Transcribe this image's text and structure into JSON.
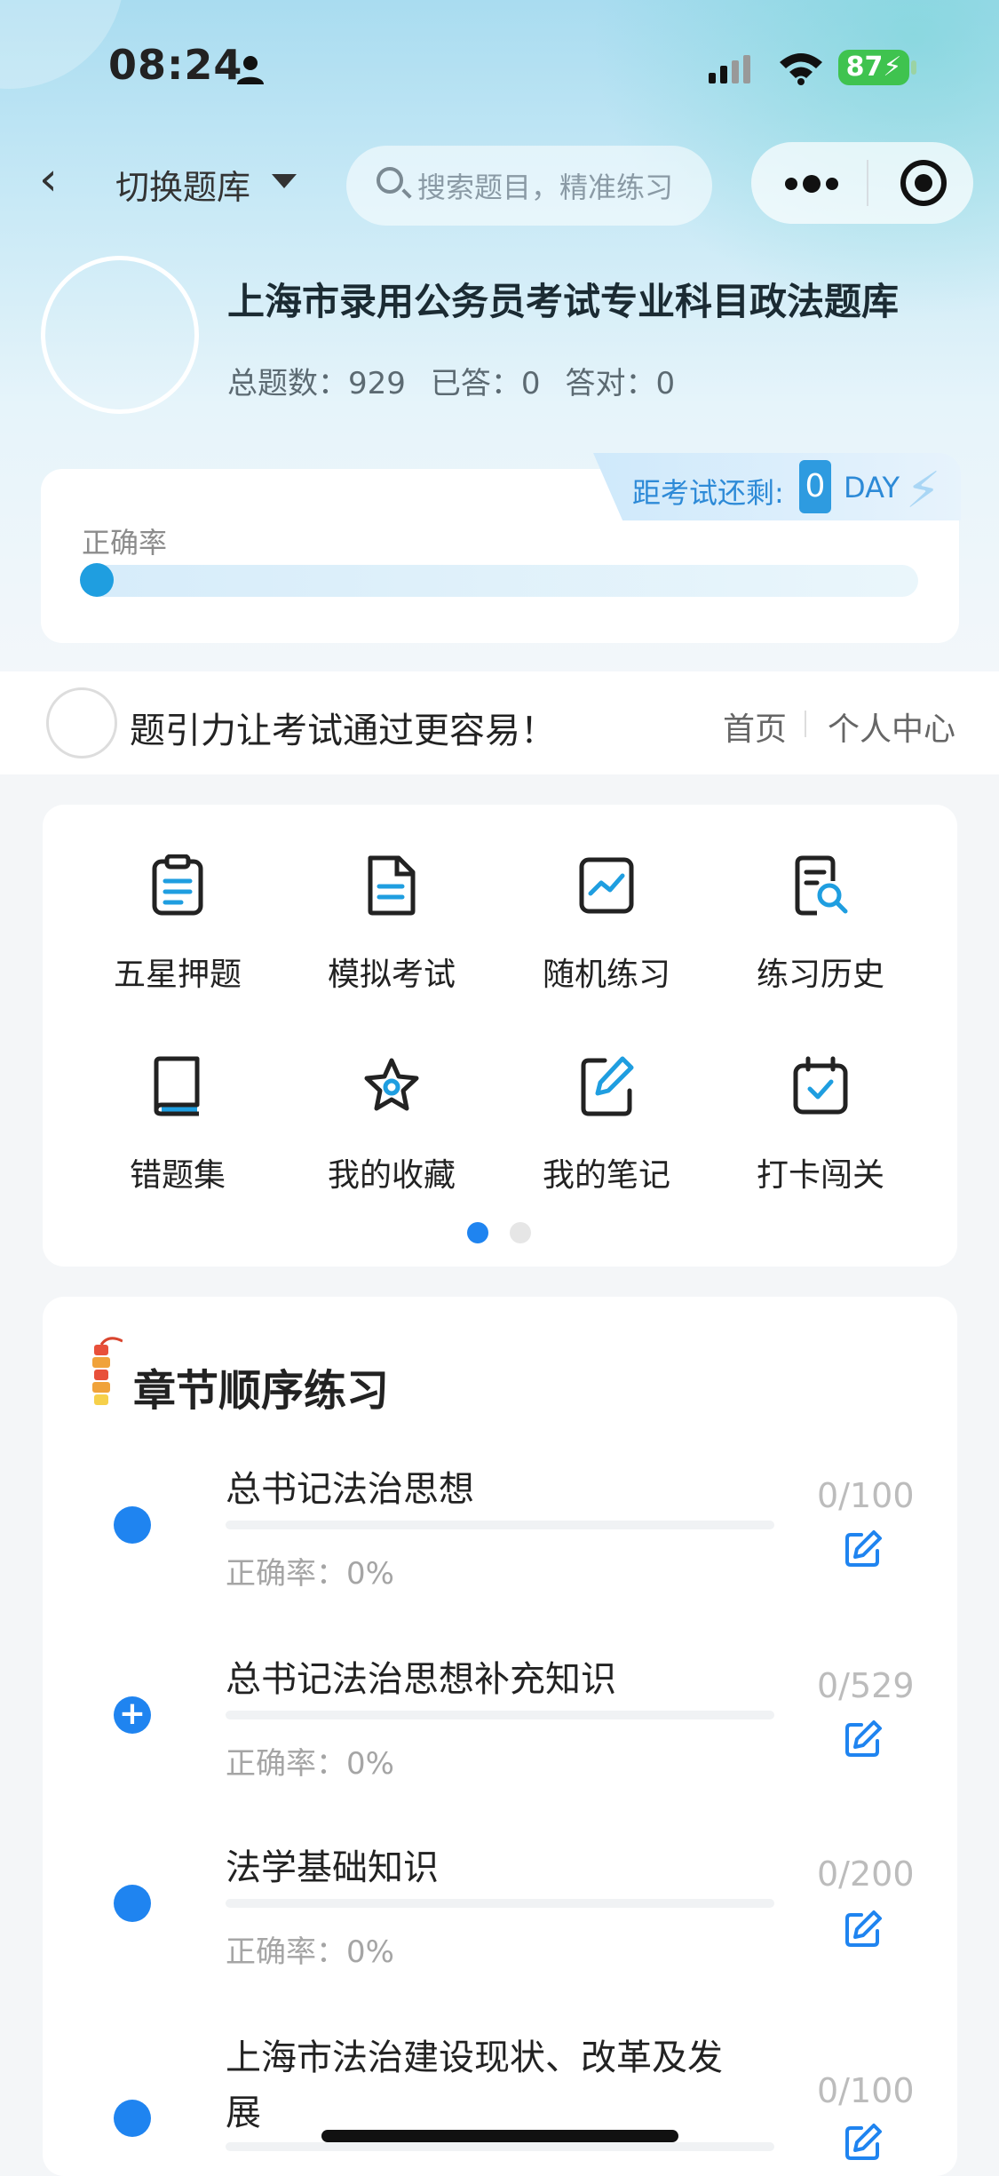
{
  "status": {
    "time": "08:24",
    "battery": "87"
  },
  "nav": {
    "switch_label": "切换题库",
    "search_placeholder": "搜索题目，精准练习"
  },
  "bank": {
    "title": "上海市录用公务员考试专业科目政法题库",
    "total_label": "总题数：929",
    "answered_label": "已答：0",
    "correct_label": "答对：0"
  },
  "countdown": {
    "label": "距考试还剩:",
    "value": "0",
    "unit": "DAY"
  },
  "accuracy": {
    "label": "正确率",
    "value": 0
  },
  "brand": {
    "logo_text": "题引力",
    "slogan": "题引力让考试通过更容易！",
    "home": "首页",
    "center": "个人中心"
  },
  "grid": {
    "items": [
      {
        "label": "五星押题",
        "icon": "clipboard-icon"
      },
      {
        "label": "模拟考试",
        "icon": "document-icon"
      },
      {
        "label": "随机练习",
        "icon": "trend-chart-icon"
      },
      {
        "label": "练习历史",
        "icon": "history-search-icon"
      },
      {
        "label": "错题集",
        "icon": "book-icon"
      },
      {
        "label": "我的收藏",
        "icon": "star-icon"
      },
      {
        "label": "我的笔记",
        "icon": "note-edit-icon"
      },
      {
        "label": "打卡闯关",
        "icon": "calendar-check-icon"
      }
    ],
    "page_count": 2,
    "current_page": 1
  },
  "chapters": {
    "title": "章节顺序练习",
    "items": [
      {
        "name": "总书记法治思想",
        "accuracy": "正确率：0%",
        "progress": "0/100",
        "expandable": false
      },
      {
        "name": "总书记法治思想补充知识",
        "accuracy": "正确率：0%",
        "progress": "0/529",
        "expandable": true
      },
      {
        "name": "法学基础知识",
        "accuracy": "正确率：0%",
        "progress": "0/200",
        "expandable": false
      },
      {
        "name_line1": "上海市法治建设现状、改革及发",
        "name_line2": "展",
        "progress": "0/100",
        "expandable": false
      }
    ]
  },
  "colors": {
    "accent": "#1f84f0",
    "icon_dark": "#222222",
    "icon_blue": "#1f9ee0"
  }
}
